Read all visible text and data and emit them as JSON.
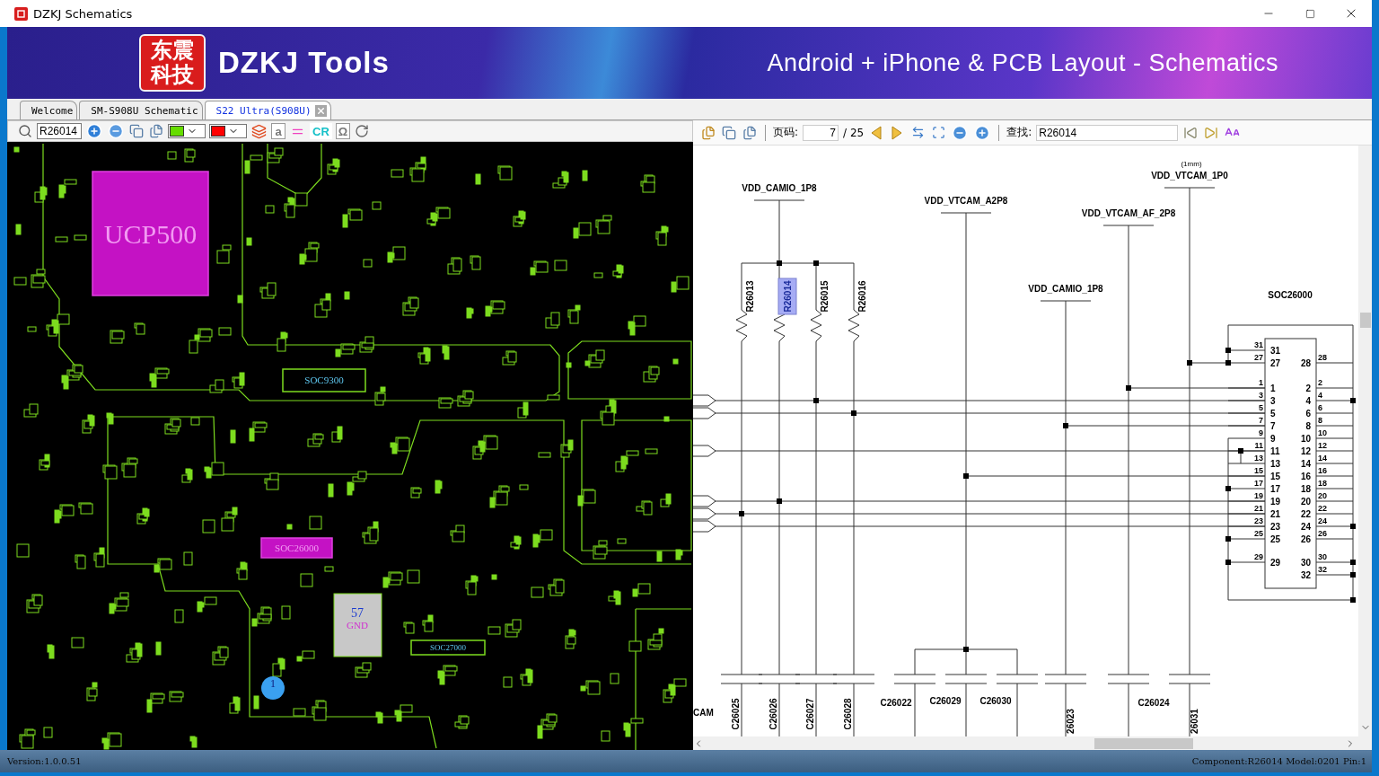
{
  "window": {
    "title": "DZKJ Schematics"
  },
  "banner": {
    "logo_lines": [
      "东震",
      "科技"
    ],
    "product": "DZKJ Tools",
    "tagline": "Android + iPhone & PCB Layout - Schematics"
  },
  "tabs": [
    {
      "label": "Welcome",
      "selected": false,
      "closable": false
    },
    {
      "label": "SM-S908U Schematic",
      "selected": false,
      "closable": false
    },
    {
      "label": "S22 Ultra(S908U)",
      "selected": true,
      "closable": true
    }
  ],
  "pcb_view": {
    "toolbar": {
      "search_value": "R26014",
      "swatches": [
        {
          "color": "#66dd00"
        },
        {
          "color": "#ff0000"
        }
      ],
      "letter_tool": "a",
      "cr_tool": "CR",
      "omega_tool": "Ω"
    },
    "components": [
      {
        "ref": "UCP500",
        "highlighted": true
      },
      {
        "ref": "SOC9300",
        "highlighted": false
      },
      {
        "ref": "SOC26000",
        "highlighted": true
      },
      {
        "ref": "SOC27000",
        "highlighted": false
      }
    ],
    "net_marker": {
      "number": "57",
      "net": "GND"
    },
    "pin_marker": "1"
  },
  "schematic_view": {
    "toolbar": {
      "page_label": "页码:",
      "page_value": "7",
      "page_total": "/ 25",
      "find_label": "查找:",
      "find_value": "R26014"
    },
    "net_labels": [
      "VDD_CAMIO_1P8",
      "VDD_VTCAM_A2P8",
      "VDD_VTCAM_AF_2P8",
      "VDD_CAMIO_1P8",
      "VDD_VTCAM_1P0"
    ],
    "note": "(1mm)",
    "resistors": [
      {
        "ref": "R26013",
        "selected": false
      },
      {
        "ref": "R26014",
        "selected": true
      },
      {
        "ref": "R26015",
        "selected": false
      },
      {
        "ref": "R26016",
        "selected": false
      }
    ],
    "capacitors": [
      "C26025",
      "C26026",
      "C26027",
      "C26028",
      "C26022",
      "C26029",
      "C26030",
      "26023",
      "C26024",
      "26031"
    ],
    "port_label": "CAM",
    "connector": {
      "ref": "SOC26000",
      "left_pins": [
        {
          "outer": "31",
          "inner": "31"
        },
        {
          "outer": "27",
          "inner": "27"
        },
        {
          "outer": "1",
          "inner": "1"
        },
        {
          "outer": "3",
          "inner": "3"
        },
        {
          "outer": "5",
          "inner": "5"
        },
        {
          "outer": "7",
          "inner": "7"
        },
        {
          "outer": "9",
          "inner": "9"
        },
        {
          "outer": "11",
          "inner": "11"
        },
        {
          "outer": "13",
          "inner": "13"
        },
        {
          "outer": "15",
          "inner": "15"
        },
        {
          "outer": "17",
          "inner": "17"
        },
        {
          "outer": "19",
          "inner": "19"
        },
        {
          "outer": "21",
          "inner": "21"
        },
        {
          "outer": "23",
          "inner": "23"
        },
        {
          "outer": "25",
          "inner": "25"
        },
        {
          "outer": "29",
          "inner": "29"
        }
      ],
      "right_pins": [
        {
          "outer": "28",
          "inner": "28"
        },
        {
          "outer": "2",
          "inner": "2"
        },
        {
          "outer": "4",
          "inner": "4"
        },
        {
          "outer": "6",
          "inner": "6"
        },
        {
          "outer": "8",
          "inner": "8"
        },
        {
          "outer": "10",
          "inner": "10"
        },
        {
          "outer": "12",
          "inner": "12"
        },
        {
          "outer": "14",
          "inner": "14"
        },
        {
          "outer": "16",
          "inner": "16"
        },
        {
          "outer": "18",
          "inner": "18"
        },
        {
          "outer": "20",
          "inner": "20"
        },
        {
          "outer": "22",
          "inner": "22"
        },
        {
          "outer": "24",
          "inner": "24"
        },
        {
          "outer": "26",
          "inner": "26"
        },
        {
          "outer": "30",
          "inner": "30"
        },
        {
          "outer": "32",
          "inner": "32"
        }
      ]
    }
  },
  "status_bar": {
    "version": "Version:1.0.0.51",
    "component_info": "Component:R26014 Model:0201 Pin:1"
  }
}
